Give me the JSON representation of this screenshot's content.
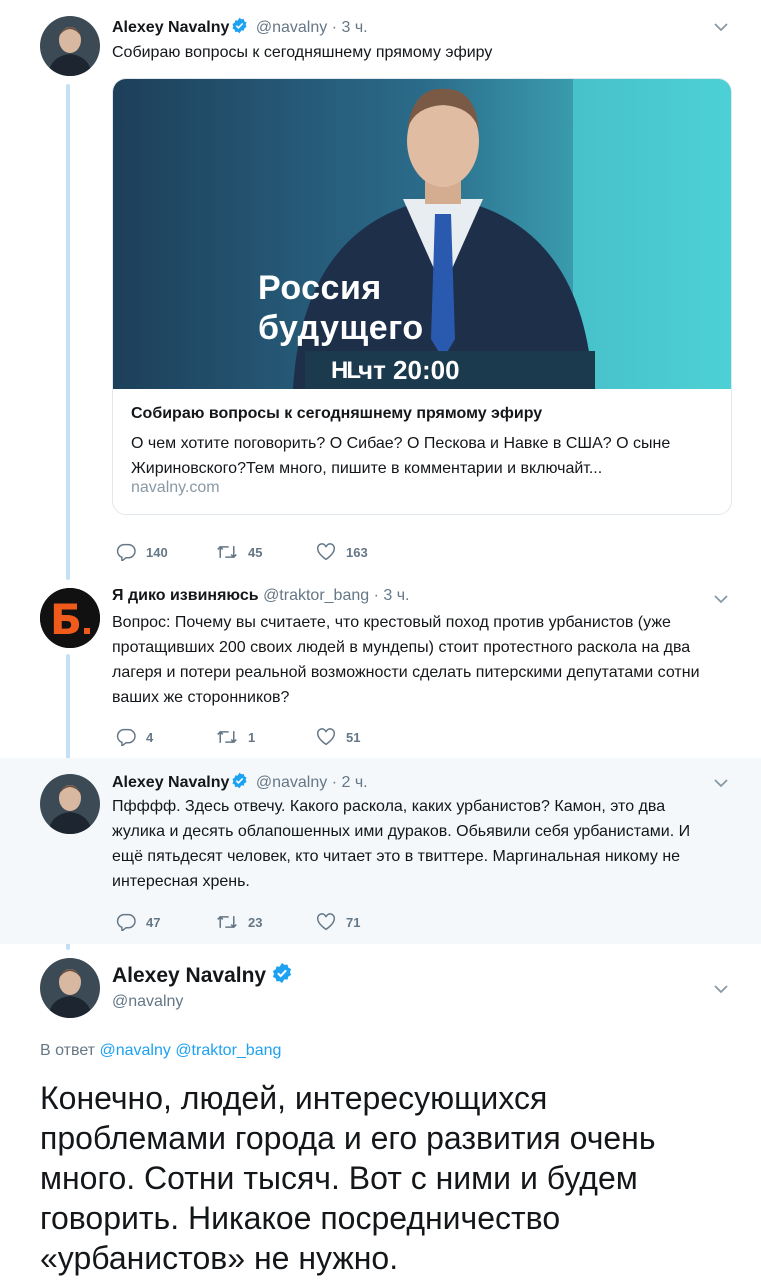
{
  "tweets": [
    {
      "name": "Alexey Navalny",
      "handle": "@navalny",
      "dot": "·",
      "time": "3 ч.",
      "text": "Собираю вопросы к сегодняшнему прямому эфиру",
      "card": {
        "image_title_line1": "Россия",
        "image_title_line2": "будущего",
        "image_logo": "НL",
        "image_time": "чт 20:00",
        "title": "Собираю вопросы к сегодняшнему прямому эфиру",
        "description": "О чем хотите поговорить? О Сибае? О Пескова и Навке в США? О сыне Жириновского?Тем много, пишите в комментарии и включайт...",
        "domain": "navalny.com"
      },
      "replies": "140",
      "retweets": "45",
      "likes": "163"
    },
    {
      "name": "Я дико извиняюсь",
      "handle": "@traktor_bang",
      "dot": "·",
      "time": "3 ч.",
      "avatar_letter": "Б.",
      "text": "Вопрос: Почему вы считаете, что крестовый поход против урбанистов (уже протащивших 200 своих людей в мундепы) стоит протестного раскола на два лагеря и потери реальной возможности сделать питерскими депутатами сотни ваших же сторонников?",
      "replies": "4",
      "retweets": "1",
      "likes": "51"
    },
    {
      "name": "Alexey Navalny",
      "handle": "@navalny",
      "dot": "·",
      "time": "2 ч.",
      "text": "Пфффф. Здесь отвечу. Какого раскола, каких урбанистов? Камон, это два жулика и десять облапошенных ими дураков. Обьявили себя урбанистами. И ещё пятьдесят человек, кто читает это в твиттере. Маргинальная никому не интересная хрень.",
      "replies": "47",
      "retweets": "23",
      "likes": "71"
    }
  ],
  "main_tweet": {
    "name": "Alexey Navalny",
    "handle": "@navalny",
    "reply_prefix": "В ответ",
    "reply_mention_1": "@navalny",
    "reply_mention_2": "@traktor_bang",
    "text": "Конечно, людей, интересующихся проблемами города и его развития очень много. Сотни тысяч. Вот с ними и будем говорить. Никакое посредничество «урбанистов» не нужно."
  },
  "colors": {
    "accent": "#1da1f2",
    "thread_line": "#c4e0f5",
    "highlight_bg": "#f5f8fa",
    "muted": "#657786"
  },
  "icons": [
    "verified-badge-icon",
    "chevron-down-icon",
    "reply-icon",
    "retweet-icon",
    "like-icon"
  ]
}
